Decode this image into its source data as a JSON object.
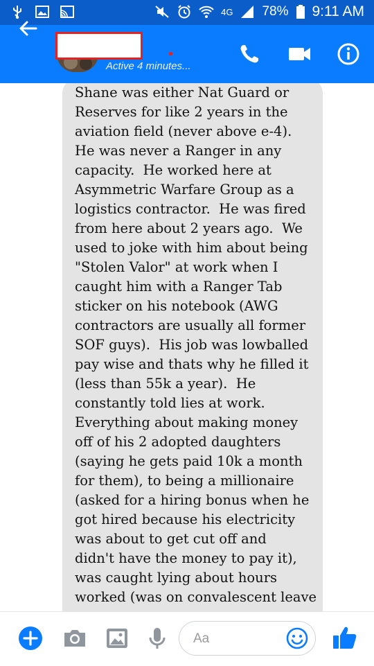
{
  "status_bar": {
    "battery": "78%",
    "time": "9:11 AM",
    "network": "4G"
  },
  "header": {
    "active_status": "Active 4 minutes..."
  },
  "message": {
    "text": "Shane was either Nat Guard or\nReserves for like 2 years in the\naviation field (never above e-4).\nHe was never a Ranger in any\ncapacity.  He worked here at\nAsymmetric Warfare Group as a\nlogistics contractor.  He was fired\nfrom here about 2 years ago.  We\nused to joke with him about being\n\"Stolen Valor\" at work when I\ncaught him with a Ranger Tab\nsticker on his notebook (AWG\ncontractors are usually all former\nSOF guys).  His job was lowballed\npay wise and thats why he filled it\n(less than 55k a year).  He\nconstantly told lies at work.\nEverything about making money\noff of his 2 adopted daughters\n(saying he gets paid 10k a month\nfor them), to being a millionaire\n(asked for a hiring bonus when he\ngot hired because his electricity\nwas about to get cut off and\ndidn't have the money to pay it),\nwas caught lying about hours\nworked (was on convalescent leave"
  },
  "composer": {
    "placeholder": "Aa"
  },
  "colors": {
    "header": "#0a7cff",
    "status_bar": "#0b5ec9",
    "accent": "#0a7cff",
    "bubble": "#e4e4e4",
    "redaction_border": "#e22323"
  },
  "icons": {
    "back": "arrow-left-icon",
    "call": "phone-icon",
    "video": "video-camera-icon",
    "info": "info-icon",
    "add": "plus-icon",
    "camera": "camera-icon",
    "gallery": "image-icon",
    "mic": "microphone-icon",
    "emoji": "smiley-icon",
    "like": "thumbs-up-icon"
  }
}
